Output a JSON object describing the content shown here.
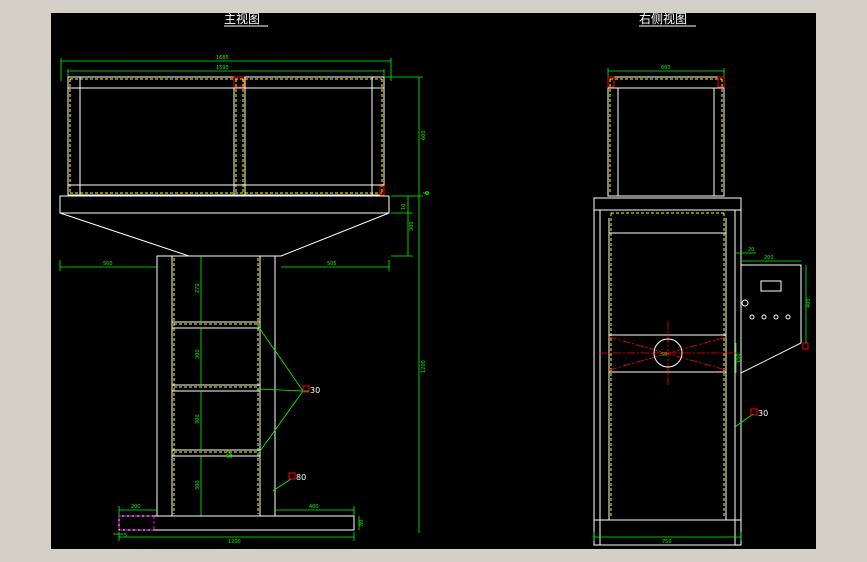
{
  "views": {
    "front_title": "主视图",
    "side_title": "右侧视图"
  },
  "front_dims": {
    "overall_width": "1685",
    "inner_width": "1593",
    "hopper_height": "600",
    "plate_thickness": "10",
    "cone_height": "300",
    "left_overhang": "500",
    "right_overhang": "505",
    "column_height": "1200",
    "seg_top": "270",
    "seg_mid1": "300",
    "seg_mid2": "300",
    "seg_bottom": "300",
    "base_left": "200",
    "base_right": "400",
    "base_width": "1200",
    "base_height": "80",
    "base_offset": "5",
    "tube_label_1": "30",
    "tube_label_2": "80",
    "bracket_label": "50"
  },
  "side_dims": {
    "top_width": "600",
    "base_width": "750",
    "panel_gap": "20",
    "panel_width": "200",
    "panel_height": "400",
    "panel_bottom": "150",
    "tube_label": "30",
    "mark_w": "50"
  }
}
